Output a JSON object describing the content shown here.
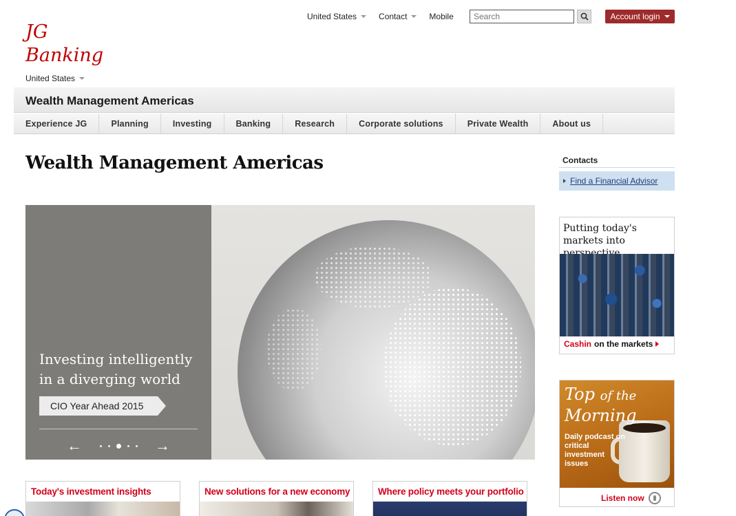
{
  "utility": {
    "country_label": "United States",
    "contact_label": "Contact",
    "mobile_label": "Mobile",
    "search_placeholder": "Search",
    "search_icon": "magnifier-icon",
    "account_login_label": "Account login"
  },
  "brand": {
    "logo_line1": "JG",
    "logo_line2": "Banking",
    "country_selector": "United States",
    "brand_color": "#c00000"
  },
  "header": {
    "section_title": "Wealth Management Americas"
  },
  "nav": {
    "tabs": [
      {
        "label": "Experience JG"
      },
      {
        "label": "Planning"
      },
      {
        "label": "Investing"
      },
      {
        "label": "Banking"
      },
      {
        "label": "Research"
      },
      {
        "label": "Corporate solutions"
      },
      {
        "label": "Private Wealth"
      },
      {
        "label": "About us"
      }
    ]
  },
  "main": {
    "page_title": "Wealth Management Americas",
    "hero": {
      "headline": "Investing intelligently in a diverging world",
      "cta_label": "CIO Year Ahead 2015",
      "prev_icon": "arrow-left-icon",
      "next_icon": "arrow-right-icon",
      "slide_count": 5,
      "active_slide": 3
    },
    "cards": [
      {
        "title": "Today's investment insights"
      },
      {
        "title": "New solutions for a new economy"
      },
      {
        "title": "Where policy meets your portfolio"
      }
    ]
  },
  "sidebar": {
    "contacts_heading": "Contacts",
    "advisor_link": "Find a Financial Advisor",
    "promo_markets": {
      "title": "Putting today's markets into perspective",
      "footer_red": "Cashin",
      "footer_text": "on the markets"
    },
    "promo_podcast": {
      "title_top": "Top",
      "title_of_the": "of the",
      "title_morning": "Morning",
      "subtitle": "Daily podcast on critical investment issues",
      "listen_label": "Listen now",
      "icon": "podcast-icon"
    }
  },
  "colors": {
    "accent_red": "#d3001b",
    "login_button": "#9e2a2b",
    "link_blue": "#1f3f7a"
  }
}
